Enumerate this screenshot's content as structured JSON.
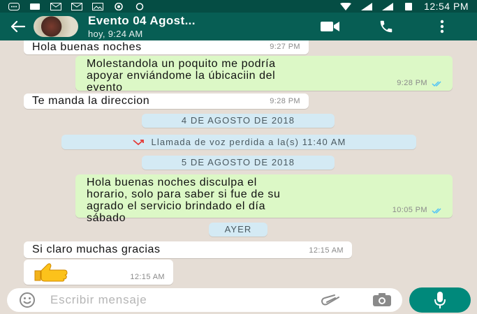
{
  "status_bar": {
    "time": "12:54 PM"
  },
  "header": {
    "title": "Evento 04 Agost...",
    "subtitle": "hoy, 9:24 AM"
  },
  "messages": [
    {
      "dir": "in",
      "text": "Hola buenas noches",
      "time": "9:27 PM"
    },
    {
      "dir": "out",
      "lines": [
        "Molestandola un poquito me podría",
        "apoyar enviándome la úbicaciin del",
        "evento"
      ],
      "time": "9:28 PM",
      "status": "read"
    },
    {
      "dir": "in",
      "text": "Te manda la direccion",
      "time": "9:28 PM"
    },
    {
      "dir": "out",
      "lines": [
        "Hola buenas noches disculpa el",
        "horario, solo para saber si fue de su",
        "agrado el servicio brindado el día",
        "sábado"
      ],
      "time": "10:05 PM",
      "status": "read"
    },
    {
      "dir": "in",
      "text": "Si claro muchas gracias",
      "time": "12:15 AM"
    },
    {
      "dir": "in",
      "emoji": "thumbs-up",
      "time": "12:15 AM"
    }
  ],
  "date_dividers": {
    "aug4": "4 DE AGOSTO DE 2018",
    "aug5": "5 DE AGOSTO DE 2018",
    "yesterday": "AYER"
  },
  "missed_call": "Llamada de voz perdida a la(s) 11:40 AM",
  "composer": {
    "placeholder": "Escribir mensaje"
  },
  "colors": {
    "header": "#075e54",
    "status_bar": "#054d44",
    "outgoing_bubble": "#dcf8c6",
    "incoming_bubble": "#ffffff",
    "chat_background": "#e5ddd5",
    "date_pill": "#d4eaf4",
    "read_ticks": "#4fc3f7",
    "mic_button": "#00897b"
  },
  "icons": [
    "back-arrow-icon",
    "video-call-icon",
    "phone-icon",
    "more-options-icon",
    "missed-call-icon",
    "emoji-icon",
    "attach-icon",
    "camera-icon",
    "mic-icon"
  ]
}
